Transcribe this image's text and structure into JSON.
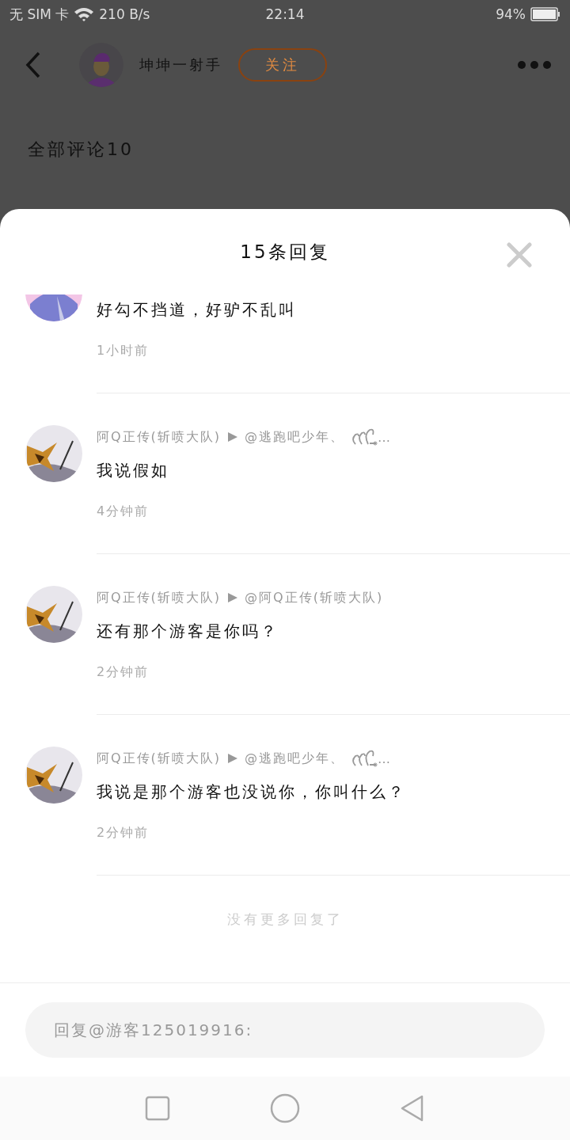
{
  "status_bar": {
    "carrier": "无 SIM 卡",
    "speed": "210 B/s",
    "time": "22:14",
    "battery": "94%"
  },
  "header": {
    "author": "坤坤一射手",
    "follow": "关注"
  },
  "comments_heading": "全部评论10",
  "sheet": {
    "title": "15条回复",
    "replies": [
      {
        "content": "好勾不挡道，好驴不乱叫",
        "time": "1小时前"
      },
      {
        "author": "阿Q正传(斩喷大队)",
        "mention": "@逃跑吧少年、",
        "mention_cut": "…",
        "content": "我说假如",
        "time": "4分钟前"
      },
      {
        "author": "阿Q正传(斩喷大队)",
        "mention": "@阿Q正传(斩喷大队)",
        "content": "还有那个游客是你吗？",
        "time": "2分钟前"
      },
      {
        "author": "阿Q正传(斩喷大队)",
        "mention": "@逃跑吧少年、",
        "mention_cut": "…",
        "content": "我说是那个游客也没说你，你叫什么？",
        "time": "2分钟前"
      }
    ],
    "end_note": "没有更多回复了",
    "reply_placeholder": "回复@游客125019916:"
  }
}
